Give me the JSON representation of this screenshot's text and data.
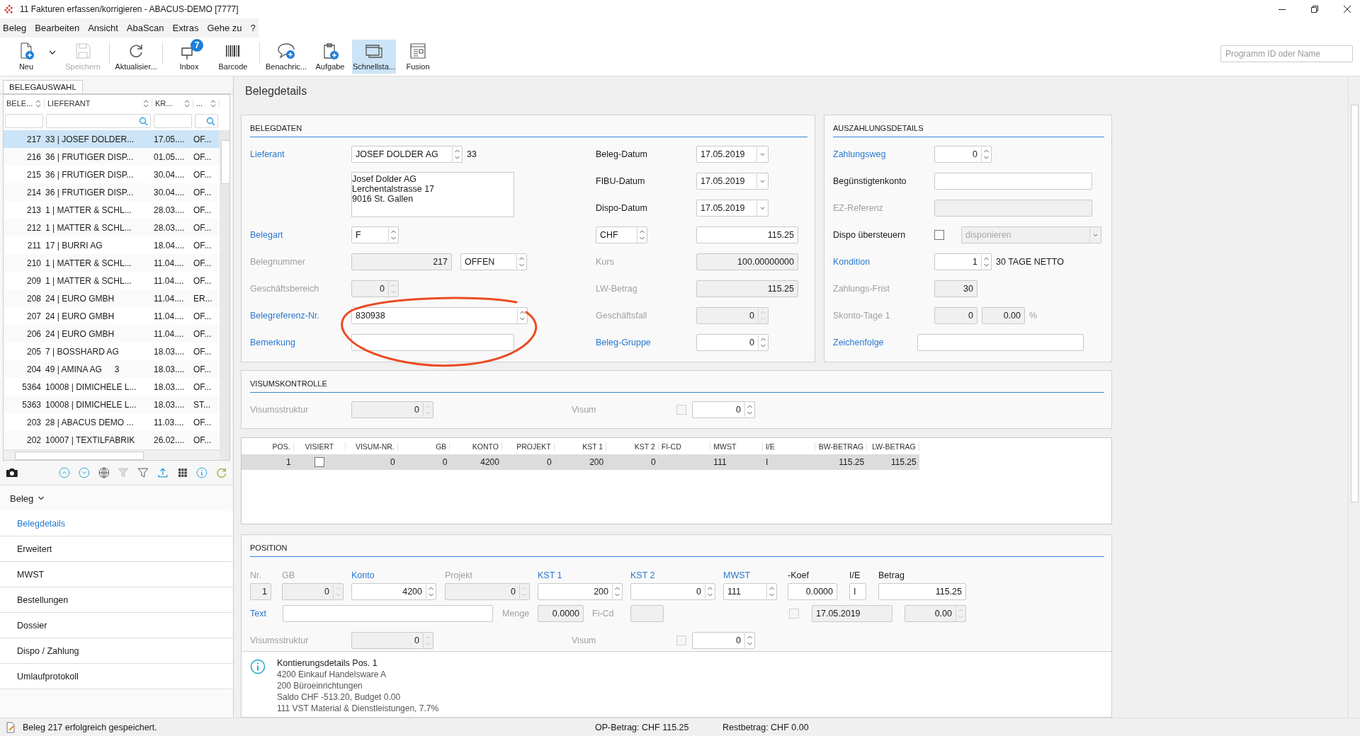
{
  "window": {
    "title": "11 Fakturen erfassen/korrigieren - ABACUS-DEMO [7777]"
  },
  "menu": [
    "Beleg",
    "Bearbeiten",
    "Ansicht",
    "AbaScan",
    "Extras",
    "Gehe zu",
    "?"
  ],
  "toolbar": [
    {
      "label": "Neu",
      "disabled": false,
      "selected": false
    },
    {
      "label": "Speichern",
      "disabled": true,
      "selected": false
    },
    {
      "label": "Aktualisier...",
      "disabled": false,
      "selected": false
    },
    {
      "label": "Inbox",
      "badge": "7",
      "disabled": false,
      "selected": false
    },
    {
      "label": "Barcode",
      "disabled": false,
      "selected": false
    },
    {
      "label": "Benachric...",
      "disabled": false,
      "selected": false
    },
    {
      "label": "Aufgabe",
      "disabled": false,
      "selected": false
    },
    {
      "label": "Schnellsta...",
      "disabled": false,
      "selected": true
    },
    {
      "label": "Fusion",
      "disabled": false,
      "selected": false
    }
  ],
  "program_search": {
    "placeholder": "Programm ID oder Name"
  },
  "belegauswahl": {
    "tab": "BELEGAUSWAHL",
    "columns": [
      {
        "label": "BELE...",
        "search_icon": false
      },
      {
        "label": "LIEFERANT",
        "search_icon": true
      },
      {
        "label": "KR...",
        "search_icon": false
      },
      {
        "label": "...",
        "search_icon": true
      }
    ],
    "rows": [
      {
        "nr": "217",
        "lieferant": "33 | JOSEF DOLDER...",
        "datum": "17.05....",
        "status": "OF...",
        "selected": true
      },
      {
        "nr": "216",
        "lieferant": "36 | FRUTIGER DISP...",
        "datum": "01.05....",
        "status": "OF...",
        "selected": false
      },
      {
        "nr": "215",
        "lieferant": "36 | FRUTIGER DISP...",
        "datum": "30.04....",
        "status": "OF...",
        "selected": false
      },
      {
        "nr": "214",
        "lieferant": "36 | FRUTIGER DISP...",
        "datum": "30.04....",
        "status": "OF...",
        "selected": false
      },
      {
        "nr": "213",
        "lieferant": "1 | MATTER & SCHL...",
        "datum": "28.03....",
        "status": "OF...",
        "selected": false
      },
      {
        "nr": "212",
        "lieferant": "1 | MATTER & SCHL...",
        "datum": "28.03....",
        "status": "OF...",
        "selected": false
      },
      {
        "nr": "211",
        "lieferant": "17 | BURRI AG",
        "datum": "18.04....",
        "status": "OF...",
        "selected": false
      },
      {
        "nr": "210",
        "lieferant": "1 | MATTER & SCHL...",
        "datum": "11.04....",
        "status": "OF...",
        "selected": false
      },
      {
        "nr": "209",
        "lieferant": "1 | MATTER & SCHL...",
        "datum": "11.04....",
        "status": "OF...",
        "selected": false
      },
      {
        "nr": "208",
        "lieferant": "24 | EURO GMBH",
        "datum": "11.04....",
        "status": "ER...",
        "selected": false
      },
      {
        "nr": "207",
        "lieferant": "24 | EURO GMBH",
        "datum": "11.04....",
        "status": "OF...",
        "selected": false
      },
      {
        "nr": "206",
        "lieferant": "24 | EURO GMBH",
        "datum": "11.04....",
        "status": "OF...",
        "selected": false
      },
      {
        "nr": "205",
        "lieferant": "7 | BOSSHARD AG",
        "datum": "18.03....",
        "status": "OF...",
        "selected": false
      },
      {
        "nr": "204",
        "lieferant": "49 | AMINA AG",
        "extra": "3",
        "datum": "18.03....",
        "status": "OF...",
        "selected": false
      },
      {
        "nr": "5364",
        "lieferant": "10008 | DIMICHELE L...",
        "datum": "18.03....",
        "status": "OF...",
        "selected": false
      },
      {
        "nr": "5363",
        "lieferant": "10008 | DIMICHELE L...",
        "datum": "18.03....",
        "status": "ST...",
        "selected": false
      },
      {
        "nr": "203",
        "lieferant": "28 | ABACUS DEMO ...",
        "datum": "11.03....",
        "status": "OF...",
        "selected": false
      },
      {
        "nr": "202",
        "lieferant": "10007 | TEXTILFABRIK",
        "datum": "26.02....",
        "status": "OF...",
        "selected": false
      }
    ]
  },
  "nav": {
    "section": "Beleg",
    "expanded": true,
    "items": [
      {
        "label": "Belegdetails",
        "selected": true
      },
      {
        "label": "Erweitert",
        "selected": false
      },
      {
        "label": "MWST",
        "selected": false
      },
      {
        "label": "Bestellungen",
        "selected": false
      },
      {
        "label": "Dossier",
        "selected": false
      },
      {
        "label": "Dispo / Zahlung",
        "selected": false
      },
      {
        "label": "Umlaufprotokoll",
        "selected": false
      }
    ]
  },
  "page_title": "Belegdetails",
  "belegdaten": {
    "title": "BELEGDATEN",
    "left": [
      [
        {
          "kind": "label",
          "text": "Lieferant",
          "link": true,
          "disabled": false
        },
        {
          "kind": "spin_text",
          "value": "JOSEF DOLDER AG",
          "disabled": false
        },
        {
          "kind": "note",
          "text": "33"
        }
      ],
      [
        {
          "kind": "memo",
          "lines": [
            "Josef Dolder AG",
            "Lerchentalstrasse 17",
            "9016 St. Gallen"
          ]
        }
      ],
      [
        {
          "kind": "label",
          "text": "Belegart",
          "link": true,
          "disabled": false
        },
        {
          "kind": "spin_text",
          "value": "F",
          "disabled": false
        }
      ],
      [
        {
          "kind": "label",
          "text": "Belegnummer",
          "link": false,
          "disabled": true
        },
        {
          "kind": "number",
          "value": "217",
          "disabled": true
        },
        {
          "kind": "spin_text",
          "value": "OFFEN",
          "disabled": false
        }
      ],
      [
        {
          "kind": "label",
          "text": "Geschäftsbereich",
          "link": false,
          "disabled": true
        },
        {
          "kind": "spin",
          "value": "0",
          "disabled": true
        }
      ],
      [
        {
          "kind": "label",
          "text": "Belegreferenz-Nr.",
          "link": true,
          "disabled": false
        },
        {
          "kind": "spin_text",
          "value": "830938",
          "disabled": false
        }
      ],
      [
        {
          "kind": "label",
          "text": "Bemerkung",
          "link": true,
          "disabled": false
        },
        {
          "kind": "text",
          "disabled": false
        }
      ]
    ],
    "right": [
      [
        {
          "kind": "label",
          "text": "Beleg-Datum",
          "link": false,
          "disabled": false
        },
        {
          "kind": "date",
          "value": "17.05.2019",
          "disabled": false
        }
      ],
      [
        {
          "kind": "label",
          "text": "FIBU-Datum",
          "link": false,
          "disabled": false
        },
        {
          "kind": "date",
          "value": "17.05.2019",
          "disabled": false
        }
      ],
      [
        {
          "kind": "label",
          "text": "Dispo-Datum",
          "link": false,
          "disabled": false
        },
        {
          "kind": "date",
          "value": "17.05.2019",
          "disabled": false
        }
      ],
      [
        {
          "kind": "spin_text",
          "value": "CHF",
          "disabled": false
        },
        {
          "kind": "number",
          "value": "115.25",
          "disabled": false
        }
      ],
      [
        {
          "kind": "label",
          "text": "Kurs",
          "link": false,
          "disabled": true
        },
        {
          "kind": "number",
          "value": "100.00000000",
          "disabled": true
        }
      ],
      [
        {
          "kind": "label",
          "text": "LW-Betrag",
          "link": false,
          "disabled": true
        },
        {
          "kind": "number",
          "value": "115.25",
          "disabled": true
        }
      ],
      [
        {
          "kind": "label",
          "text": "Geschäftsfall",
          "link": false,
          "disabled": true
        },
        {
          "kind": "spin",
          "value": "0",
          "disabled": true
        }
      ],
      [
        {
          "kind": "label",
          "text": "Beleg-Gruppe",
          "link": true,
          "disabled": false
        },
        {
          "kind": "spin",
          "value": "0",
          "disabled": false
        }
      ]
    ]
  },
  "auszahlung": {
    "title": "AUSZAHLUNGSDETAILS",
    "rows": [
      [
        {
          "kind": "label",
          "text": "Zahlungsweg",
          "link": true,
          "disabled": false
        },
        {
          "kind": "spin",
          "value": "0",
          "disabled": false
        }
      ],
      [
        {
          "kind": "label",
          "text": "Begünstigtenkonto",
          "link": false,
          "disabled": false
        },
        {
          "kind": "text",
          "disabled": false
        }
      ],
      [
        {
          "kind": "label",
          "text": "EZ-Referenz",
          "link": false,
          "disabled": true
        },
        {
          "kind": "text",
          "disabled": true
        }
      ],
      [
        {
          "kind": "label",
          "text": "Dispo übersteuern",
          "link": false,
          "disabled": false
        },
        {
          "kind": "check",
          "checked": false,
          "disabled": false
        },
        {
          "kind": "combo",
          "placeholder": "disponieren",
          "disabled": true
        }
      ],
      [
        {
          "kind": "label",
          "text": "Kondition",
          "link": true,
          "disabled": false
        },
        {
          "kind": "spin",
          "value": "1",
          "disabled": false
        },
        {
          "kind": "note",
          "text": "30 TAGE NETTO"
        }
      ],
      [
        {
          "kind": "label",
          "text": "Zahlungs-Frist",
          "link": false,
          "disabled": true
        },
        {
          "kind": "number",
          "value": "30",
          "disabled": true
        }
      ],
      [
        {
          "kind": "label",
          "text": "Skonto-Tage 1",
          "link": false,
          "disabled": true
        },
        {
          "kind": "number",
          "value": "0",
          "disabled": true
        },
        {
          "kind": "number",
          "value": "0.00",
          "disabled": true
        },
        {
          "kind": "label",
          "text": "%",
          "link": false,
          "disabled": true
        }
      ],
      [
        {
          "kind": "label",
          "text": "Zeichenfolge",
          "link": true,
          "disabled": false
        },
        {
          "kind": "text",
          "disabled": false
        }
      ]
    ]
  },
  "visumskontrolle": {
    "title": "VISUMSKONTROLLE",
    "row": [
      {
        "kind": "label",
        "text": "Visumsstruktur",
        "link": false,
        "disabled": true
      },
      {
        "kind": "spin",
        "value": "0",
        "disabled": true
      },
      {
        "kind": "label",
        "text": "Visum",
        "link": false,
        "disabled": true
      },
      {
        "kind": "check",
        "checked": false,
        "disabled": true
      },
      {
        "kind": "spin",
        "value": "0",
        "disabled": false
      }
    ]
  },
  "positionen_table": {
    "columns": [
      {
        "label": "POS.",
        "kind": "number"
      },
      {
        "label": "VISIERT",
        "kind": "check"
      },
      {
        "label": "VISUM-NR.",
        "kind": "number"
      },
      {
        "label": "GB",
        "kind": "number"
      },
      {
        "label": "KONTO",
        "kind": "number"
      },
      {
        "label": "PROJEKT",
        "kind": "number"
      },
      {
        "label": "KST 1",
        "kind": "number"
      },
      {
        "label": "KST 2",
        "kind": "number"
      },
      {
        "label": "FI-CD",
        "kind": "text"
      },
      {
        "label": "MWST",
        "kind": "text"
      },
      {
        "label": "I/E",
        "kind": "text"
      },
      {
        "label": "BW-BETRAG",
        "kind": "number"
      },
      {
        "label": "LW-BETRAG",
        "kind": "number"
      }
    ],
    "rows": [
      {
        "selected": true,
        "cells": [
          {
            "text": "1"
          },
          {
            "checked": false
          },
          {
            "text": "0"
          },
          {
            "text": "0"
          },
          {
            "text": "4200"
          },
          {
            "text": "0"
          },
          {
            "text": "200"
          },
          {
            "text": "0"
          },
          {},
          {
            "text": "111"
          },
          {
            "text": "I"
          },
          {
            "text": "115.25"
          },
          {
            "text": "115.25"
          }
        ]
      }
    ]
  },
  "position": {
    "title": "POSITION",
    "columns": [
      {
        "label": "Nr.",
        "link": false,
        "disabled": true,
        "control": {
          "kind": "number",
          "value": "1",
          "disabled": true
        }
      },
      {
        "label": "GB",
        "link": false,
        "disabled": true,
        "control": {
          "kind": "spin",
          "value": "0",
          "disabled": true
        }
      },
      {
        "label": "Konto",
        "link": true,
        "disabled": false,
        "control": {
          "kind": "spin",
          "value": "4200",
          "disabled": false
        }
      },
      {
        "label": "Projekt",
        "link": false,
        "disabled": true,
        "control": {
          "kind": "spin",
          "value": "0",
          "disabled": true
        }
      },
      {
        "label": "KST 1",
        "link": true,
        "disabled": false,
        "control": {
          "kind": "spin",
          "value": "200",
          "disabled": false
        }
      },
      {
        "label": "KST 2",
        "link": true,
        "disabled": false,
        "control": {
          "kind": "spin",
          "value": "0",
          "disabled": false
        }
      },
      {
        "label": "MWST",
        "link": true,
        "disabled": false,
        "control": {
          "kind": "spin_text",
          "value": "111",
          "disabled": false
        }
      },
      {
        "label": "-Koef",
        "link": false,
        "disabled": false,
        "control": {
          "kind": "number",
          "value": "0.0000",
          "disabled": false
        }
      },
      {
        "label": "I/E",
        "link": false,
        "disabled": false,
        "control": {
          "kind": "text",
          "value": "I",
          "disabled": false
        }
      },
      {
        "label": "Betrag",
        "link": false,
        "disabled": false,
        "control": {
          "kind": "number",
          "value": "115.25",
          "disabled": false
        }
      }
    ],
    "line2": [
      {
        "kind": "label",
        "text": "Text",
        "link": true,
        "disabled": false
      },
      {
        "kind": "text",
        "disabled": false
      },
      {
        "kind": "label",
        "text": "Menge",
        "link": false,
        "disabled": true
      },
      {
        "kind": "number",
        "value": "0.0000",
        "disabled": true
      },
      {
        "kind": "label",
        "text": "Fi-Cd",
        "link": false,
        "disabled": true
      },
      {
        "kind": "text",
        "disabled": true
      },
      {
        "kind": "check",
        "checked": false,
        "disabled": true
      },
      {
        "kind": "text",
        "value": "17.05.2019",
        "disabled": true
      },
      {
        "kind": "spin",
        "value": "0.00",
        "disabled": true
      }
    ],
    "line3": [
      {
        "kind": "label",
        "text": "Visumsstruktur",
        "link": false,
        "disabled": true
      },
      {
        "kind": "spin",
        "value": "0",
        "disabled": true
      },
      {
        "kind": "label",
        "text": "Visum",
        "link": false,
        "disabled": true
      },
      {
        "kind": "check",
        "checked": false,
        "disabled": true
      },
      {
        "kind": "spin",
        "value": "0",
        "disabled": false
      }
    ]
  },
  "info": {
    "title": "Kontierungsdetails Pos. 1",
    "lines": [
      "4200 Einkauf Handelsware A",
      "200 Büroeinrichtungen",
      "Saldo CHF -513.20, Budget 0.00",
      "111 VST Material & Dienstleistungen, 7.7%"
    ]
  },
  "status": {
    "message": "Beleg 217 erfolgreich gespeichert.",
    "op": "OP-Betrag: CHF 115.25",
    "rest": "Restbetrag: CHF 0.00"
  }
}
